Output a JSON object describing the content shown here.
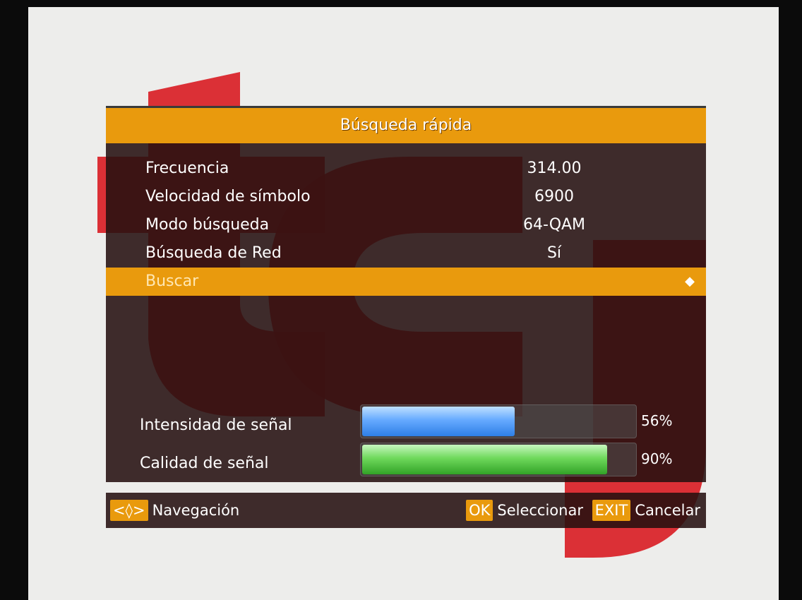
{
  "colors": {
    "accent": "#e99a0d",
    "logo_red": "#d91f26",
    "panel_bg": "#261010",
    "signal_blue": "#4a96f5",
    "quality_green": "#4cc23a"
  },
  "panel": {
    "title": "Búsqueda rápida",
    "rows": [
      {
        "label": "Frecuencia",
        "value": "314.00"
      },
      {
        "label": "Velocidad de símbolo",
        "value": "6900"
      },
      {
        "label": "Modo búsqueda",
        "value": "64-QAM"
      },
      {
        "label": "Búsqueda de Red",
        "value": "Sí"
      }
    ],
    "action": {
      "label": "Buscar",
      "icon": "arrow-right-icon"
    }
  },
  "signal": {
    "strength": {
      "label": "Intensidad de señal",
      "percent_text": "56%",
      "percent": 56
    },
    "quality": {
      "label": "Calidad de señal",
      "percent_text": "90%",
      "percent": 90
    }
  },
  "footer": {
    "nav_key": "<◊>",
    "nav_label": "Navegación",
    "ok_key": "OK",
    "ok_label": "Seleccionar",
    "exit_key": "EXIT",
    "exit_label": "Cancelar"
  }
}
